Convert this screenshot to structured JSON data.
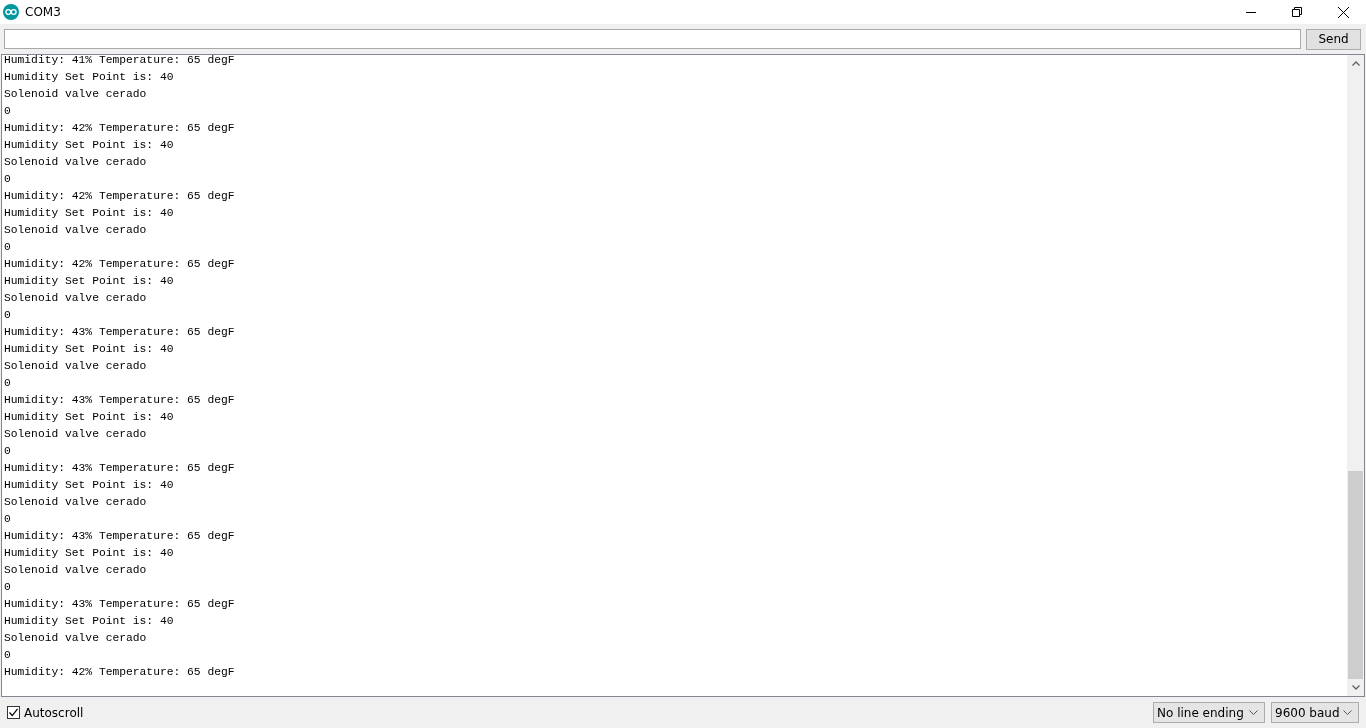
{
  "window": {
    "title": "COM3"
  },
  "send": {
    "button": "Send"
  },
  "output": {
    "lines": [
      "Humidity: 41% Temperature: 65 degF",
      "Humidity Set Point is: 40",
      "Solenoid valve cerado",
      "0",
      "Humidity: 42% Temperature: 65 degF",
      "Humidity Set Point is: 40",
      "Solenoid valve cerado",
      "0",
      "Humidity: 42% Temperature: 65 degF",
      "Humidity Set Point is: 40",
      "Solenoid valve cerado",
      "0",
      "Humidity: 42% Temperature: 65 degF",
      "Humidity Set Point is: 40",
      "Solenoid valve cerado",
      "0",
      "Humidity: 43% Temperature: 65 degF",
      "Humidity Set Point is: 40",
      "Solenoid valve cerado",
      "0",
      "Humidity: 43% Temperature: 65 degF",
      "Humidity Set Point is: 40",
      "Solenoid valve cerado",
      "0",
      "Humidity: 43% Temperature: 65 degF",
      "Humidity Set Point is: 40",
      "Solenoid valve cerado",
      "0",
      "Humidity: 43% Temperature: 65 degF",
      "Humidity Set Point is: 40",
      "Solenoid valve cerado",
      "0",
      "Humidity: 43% Temperature: 65 degF",
      "Humidity Set Point is: 40",
      "Solenoid valve cerado",
      "0",
      "Humidity: 42% Temperature: 65 degF"
    ]
  },
  "footer": {
    "autoscroll": {
      "label": "Autoscroll",
      "checked": true
    },
    "line_ending": "No line ending",
    "baud": "9600 baud"
  }
}
